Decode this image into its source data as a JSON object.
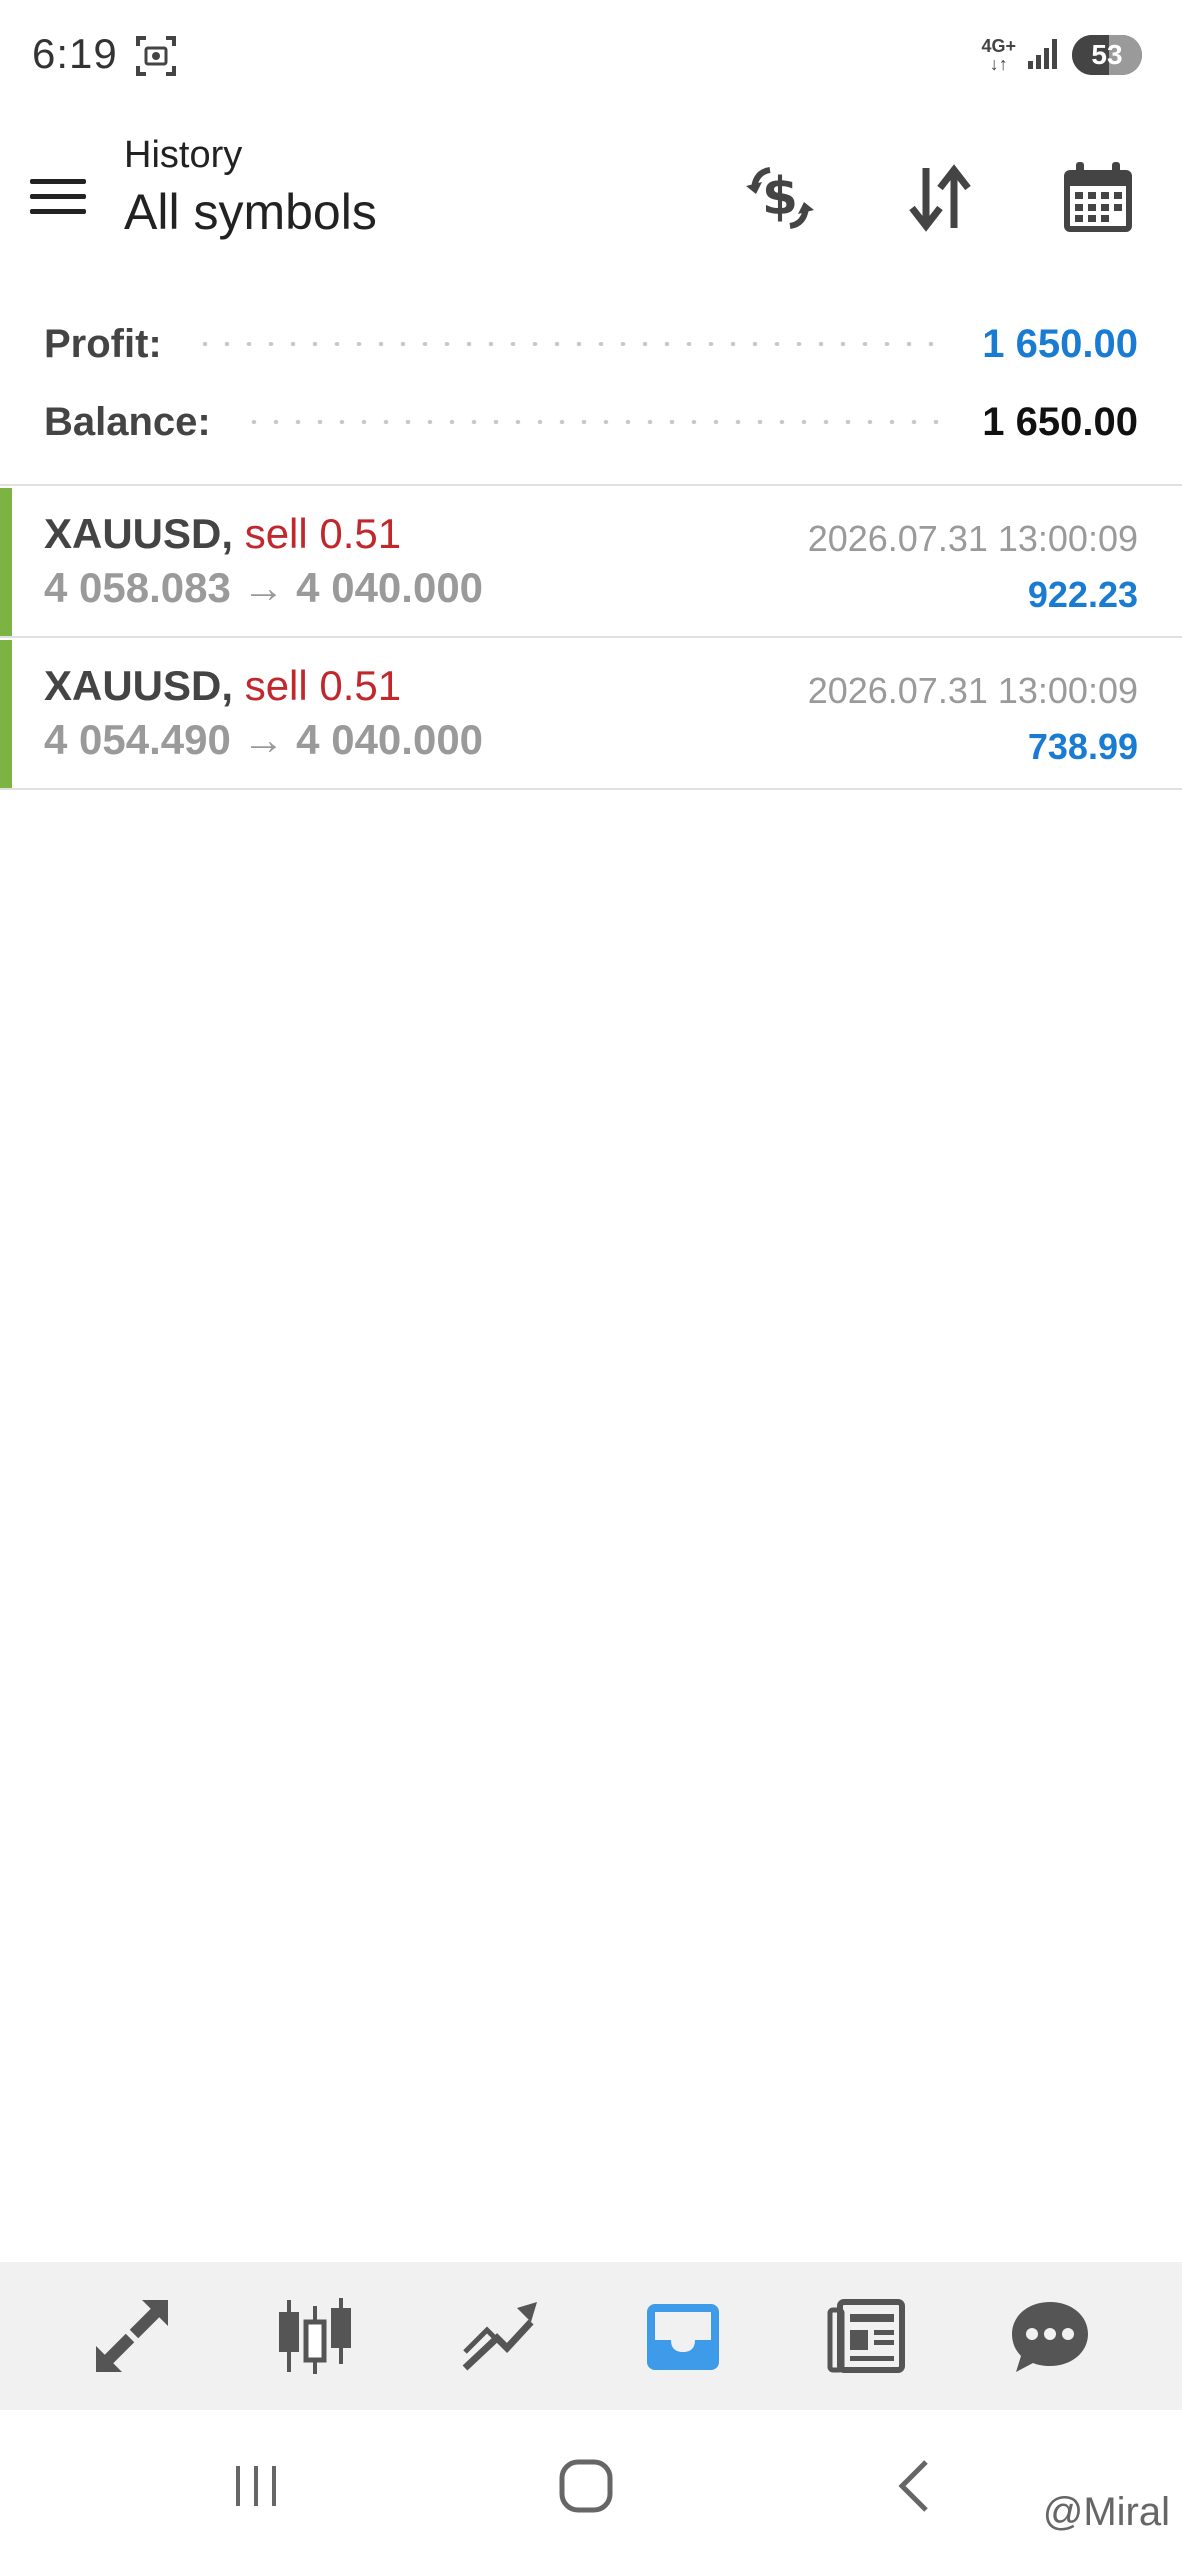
{
  "status_bar": {
    "time": "6:19",
    "network": "4G+",
    "battery": "53"
  },
  "app_bar": {
    "subtitle": "History",
    "title": "All symbols"
  },
  "summary": {
    "profit_label": "Profit:",
    "profit_value": "1 650.00",
    "balance_label": "Balance:",
    "balance_value": "1 650.00"
  },
  "trades": [
    {
      "symbol": "XAUUSD,",
      "side": "sell 0.51",
      "prices": "4 058.083 → 4 040.000",
      "time": "2026.07.31 13:00:09",
      "profit": "922.23"
    },
    {
      "symbol": "XAUUSD,",
      "side": "sell 0.51",
      "prices": "4 054.490 → 4 040.000",
      "time": "2026.07.31 13:00:09",
      "profit": "738.99"
    }
  ],
  "bottom_nav": {
    "items": [
      "quotes-icon",
      "chart-icon",
      "trade-icon",
      "history-icon",
      "news-icon",
      "chat-icon"
    ],
    "active": "history-icon"
  },
  "watermark": "@Miral",
  "colors": {
    "profit_blue": "#1a7bd3",
    "sell_red": "#c0282d",
    "accent_green": "#7cb342",
    "active_nav": "#3d9be9"
  }
}
